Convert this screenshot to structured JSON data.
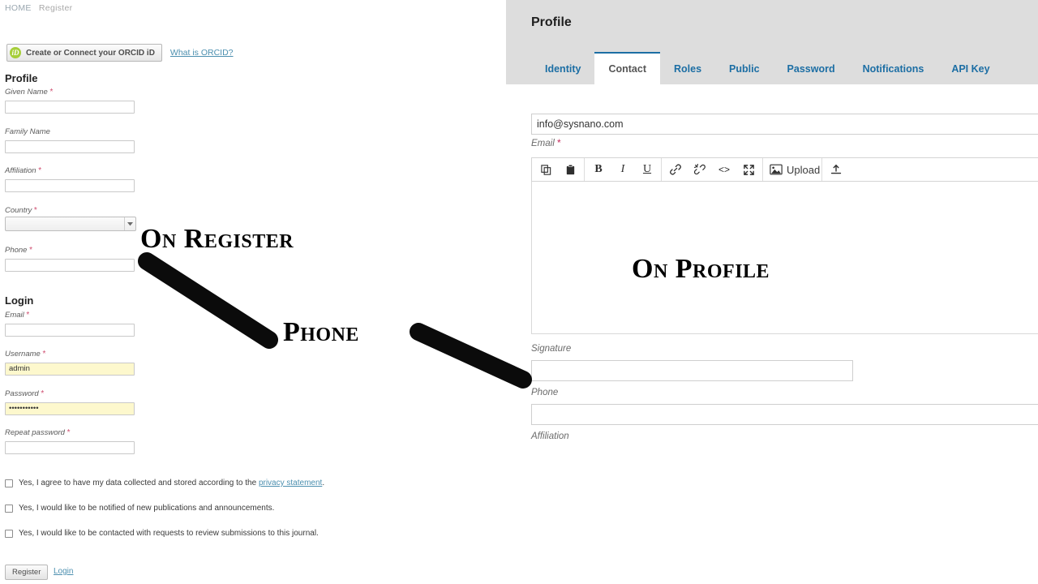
{
  "register": {
    "breadcrumb": {
      "home": "HOME",
      "separator": "/",
      "current": "Register"
    },
    "orcid": {
      "button_label": "Create or Connect your ORCID iD",
      "mark": "iD",
      "help_link": "What is ORCID?"
    },
    "profile_heading": "Profile",
    "login_heading": "Login",
    "fields": [
      {
        "label": "Given Name",
        "required": true,
        "value": "",
        "type": "text"
      },
      {
        "label": "Family Name",
        "required": false,
        "value": "",
        "type": "text"
      },
      {
        "label": "Affiliation",
        "required": true,
        "value": "",
        "type": "text"
      },
      {
        "label": "Country",
        "required": true,
        "value": "",
        "type": "select"
      },
      {
        "label": "Phone",
        "required": true,
        "value": "",
        "type": "text"
      },
      {
        "label": "Email",
        "required": true,
        "value": "",
        "type": "text"
      },
      {
        "label": "Username",
        "required": true,
        "value": "admin",
        "type": "text"
      },
      {
        "label": "Password",
        "required": true,
        "value": "•••••••••••",
        "type": "password"
      },
      {
        "label": "Repeat password",
        "required": true,
        "value": "",
        "type": "password"
      }
    ],
    "consents": [
      {
        "text_before": "Yes, I agree to have my data collected and stored according to the ",
        "link": "privacy statement",
        "text_after": ".",
        "checked": false
      },
      {
        "text_before": "Yes, I would like to be notified of new publications and announcements.",
        "link": "",
        "text_after": "",
        "checked": false
      },
      {
        "text_before": "Yes, I would like to be contacted with requests to review submissions to this journal.",
        "link": "",
        "text_after": "",
        "checked": false
      }
    ],
    "submit_label": "Register",
    "login_link": "Login"
  },
  "profile": {
    "title": "Profile",
    "tabs": [
      {
        "label": "Identity",
        "active": false
      },
      {
        "label": "Contact",
        "active": true
      },
      {
        "label": "Roles",
        "active": false
      },
      {
        "label": "Public",
        "active": false
      },
      {
        "label": "Password",
        "active": false
      },
      {
        "label": "Notifications",
        "active": false
      },
      {
        "label": "API Key",
        "active": false
      }
    ],
    "email": {
      "label": "Email",
      "required": true,
      "value": "info@sysnano.com"
    },
    "signature": {
      "label": "Signature",
      "required": false,
      "value": ""
    },
    "phone": {
      "label": "Phone",
      "required": false,
      "value": ""
    },
    "affiliation": {
      "label": "Affiliation",
      "required": false,
      "value": ""
    },
    "editor_toolbar": [
      {
        "icon": "copy-icon",
        "label": ""
      },
      {
        "icon": "paste-icon",
        "label": ""
      },
      {
        "icon": "bold-icon",
        "label": "B"
      },
      {
        "icon": "italic-icon",
        "label": "I"
      },
      {
        "icon": "underline-icon",
        "label": "U"
      },
      {
        "icon": "link-icon",
        "label": ""
      },
      {
        "icon": "unlink-icon",
        "label": ""
      },
      {
        "icon": "code-icon",
        "label": "<>"
      },
      {
        "icon": "fullscreen-icon",
        "label": ""
      },
      {
        "icon": "image-upload-icon",
        "label": "Upload"
      },
      {
        "icon": "file-upload-icon",
        "label": ""
      }
    ],
    "upload_label": "Upload"
  },
  "annotations": {
    "on_register": "On Register",
    "phone": "Phone",
    "on_profile": "On Profile"
  },
  "colors": {
    "tab_link": "#1c6ea4",
    "header_bg": "#dddddd",
    "required_mark": "#c6295b",
    "autofill_bg": "#fdf8cd",
    "orcid_green": "#a6ce39",
    "annotation": "#000000"
  }
}
